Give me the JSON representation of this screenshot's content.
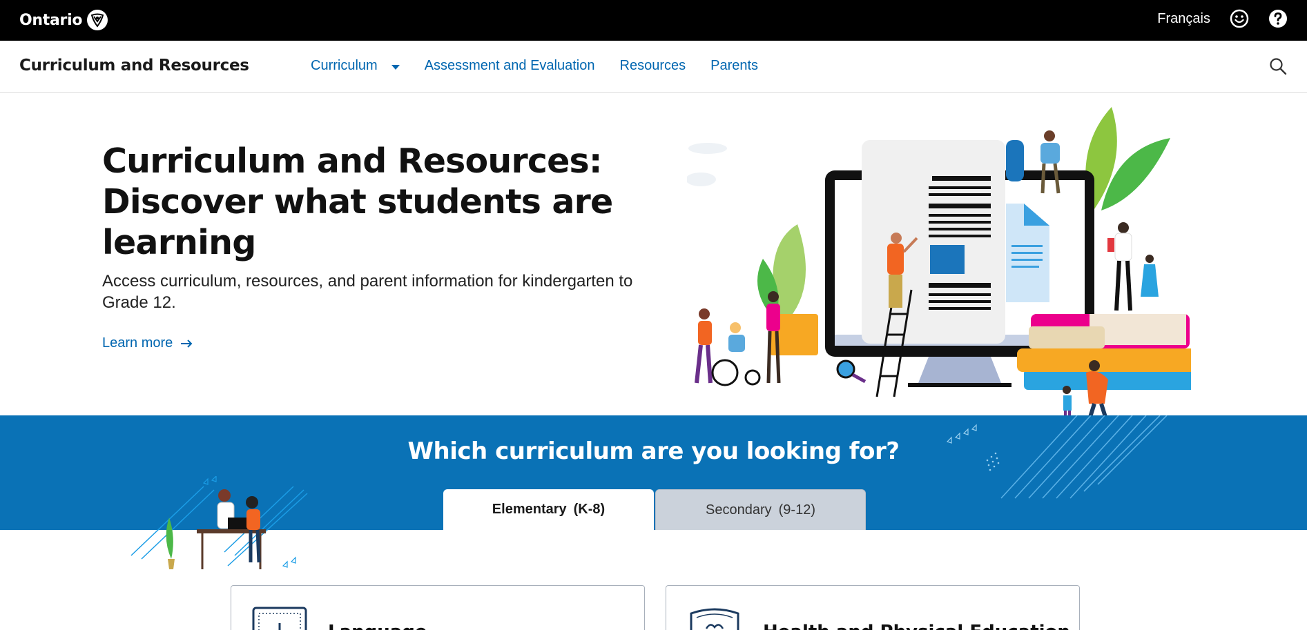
{
  "topbar": {
    "logo_text": "Ontario",
    "language_link": "Français",
    "feedback_icon": "smiley-icon",
    "help_icon": "question-circle-icon"
  },
  "subnav": {
    "site_title": "Curriculum and Resources",
    "links": [
      {
        "label": "Curriculum",
        "has_dropdown": true
      },
      {
        "label": "Assessment and Evaluation"
      },
      {
        "label": "Resources"
      },
      {
        "label": "Parents"
      }
    ],
    "search_icon": "search-icon"
  },
  "hero": {
    "title": "Curriculum and Resources: Discover what students are learning",
    "description": "Access curriculum, resources, and parent information for kindergarten to Grade 12.",
    "learn_more": "Learn more"
  },
  "curriculum_selector": {
    "heading": "Which curriculum are you looking for?",
    "tabs": [
      {
        "label": "Elementary",
        "grades": "(K-8)",
        "active": true
      },
      {
        "label": "Secondary",
        "grades": "(9-12)",
        "active": false
      }
    ]
  },
  "cards": [
    {
      "title": "Language"
    },
    {
      "title": "Health and Physical Education"
    }
  ],
  "colors": {
    "brand_blue": "#0a72b6",
    "link_blue": "#0066b0",
    "topbar": "#000000"
  }
}
